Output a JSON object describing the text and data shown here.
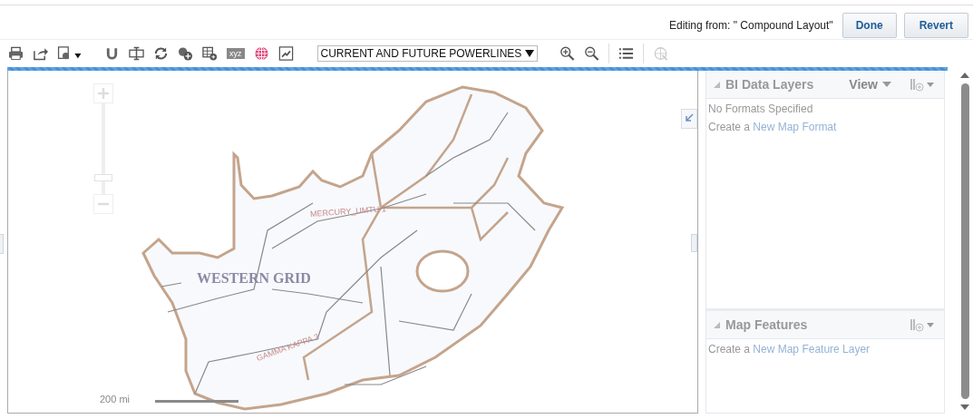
{
  "header": {
    "editing_label": "Editing from: \" Compound Layout\"",
    "buttons": [
      {
        "label": "Done"
      },
      {
        "label": "Revert"
      }
    ]
  },
  "toolbar": {
    "xyz_label": "xyz",
    "layer_select": "CURRENT AND FUTURE POWERLINES"
  },
  "map": {
    "labels": [
      {
        "kind": "region",
        "text": "WESTERN GRID"
      },
      {
        "kind": "line",
        "text": "MERCURY_UMTU 1"
      },
      {
        "kind": "line",
        "text": "GAMMA KAPPA 2"
      }
    ],
    "scale": "200 mi",
    "zoom_slider": {
      "level": 0.15
    }
  },
  "side_panel": {
    "data_layers": {
      "title": "BI Data Layers",
      "view_menu": "View",
      "empty_message": "No Formats Specified",
      "create_prefix": "Create a",
      "create_link": "New Map Format"
    },
    "map_features": {
      "title": "Map Features",
      "create_prefix": "Create a",
      "create_link": "New Map Feature Layer"
    }
  }
}
